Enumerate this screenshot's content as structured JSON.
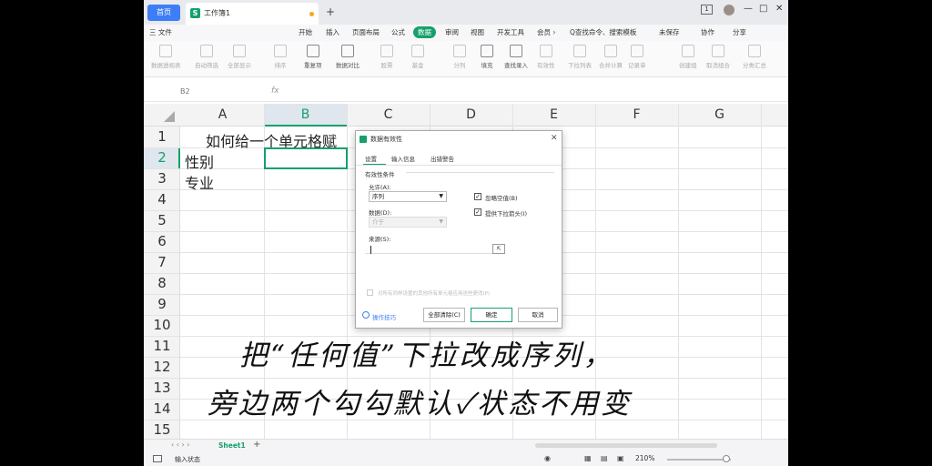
{
  "titlebar": {
    "home_tab": "首页",
    "doc_icon": "S",
    "doc_name": "工作簿1",
    "new_tab": "+",
    "badge": "1",
    "minimize": "—",
    "maximize": "□",
    "close": "✕"
  },
  "menubar": {
    "file": "三 文件",
    "items": [
      "开始",
      "插入",
      "页面布局",
      "公式",
      "数据",
      "审阅",
      "视图",
      "开发工具",
      "会员 ›"
    ],
    "search": "Q查找命令、搜索模板",
    "unsaved": "未保存",
    "collab": "协作",
    "share": "分享"
  },
  "ribbon": {
    "items": [
      "数据透视表",
      "自动筛选",
      "全部显示",
      "排序",
      "重复项",
      "数据对比",
      "股票",
      "基金",
      "分列",
      "填充",
      "查找录入",
      "有效性",
      "下拉列表",
      "合并计算",
      "记录单",
      "创建组",
      "取消组合",
      "分类汇总"
    ],
    "reapply": "重新应用",
    "simulate": "模拟分析"
  },
  "formulabar": {
    "cell_ref": "B2",
    "fx": "fx"
  },
  "grid": {
    "columns": [
      "A",
      "B",
      "C",
      "D",
      "E",
      "F",
      "G"
    ],
    "rows": [
      "1",
      "2",
      "3",
      "4",
      "5",
      "6",
      "7",
      "8",
      "9",
      "10",
      "11",
      "12",
      "13",
      "14",
      "15"
    ],
    "a1": "如何给一个单元格赋",
    "a2": "性别",
    "a3": "专业"
  },
  "dialog": {
    "title": "数据有效性",
    "tabs": [
      "设置",
      "输入信息",
      "出错警告"
    ],
    "group_label": "有效性条件",
    "allow_label": "允许(A):",
    "allow_value": "序列",
    "data_label": "数据(D):",
    "data_value": "介于",
    "ignore_blank": "忽略空值(B)",
    "dropdown_arrow": "提供下拉箭头(I)",
    "source_label": "来源(S):",
    "apply_all": "对所有同样设置的其他所有单元格应用这些更改(P)",
    "tips": "操作技巧",
    "clear_all": "全部清除(C)",
    "ok": "确定",
    "cancel": "取消",
    "check": "✓"
  },
  "overlay": {
    "line1": "把“任何值”下拉改成序列，",
    "line2": "旁边两个勾勾默认✓状态不用变"
  },
  "sheetbar": {
    "sheet": "Sheet1",
    "add": "+"
  },
  "statusbar": {
    "status": "输入状态",
    "zoom": "210%"
  }
}
